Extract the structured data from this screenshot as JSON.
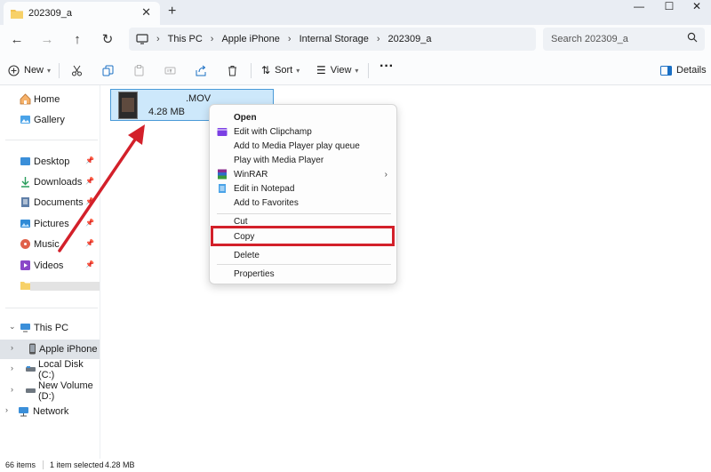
{
  "tab": {
    "title": "202309_a"
  },
  "nav": {
    "back": "back",
    "forward": "forward",
    "up": "up",
    "refresh": "refresh"
  },
  "breadcrumb": [
    "This PC",
    "Apple iPhone",
    "Internal Storage",
    "202309_a"
  ],
  "search": {
    "placeholder": "Search 202309_a"
  },
  "toolbar": {
    "new_label": "New",
    "sort_label": "Sort",
    "view_label": "View",
    "details_label": "Details"
  },
  "sidebar": {
    "top": [
      {
        "label": "Home",
        "icon": "home-icon"
      },
      {
        "label": "Gallery",
        "icon": "gallery-icon"
      }
    ],
    "quick": [
      {
        "label": "Desktop",
        "icon": "desktop-folder-icon"
      },
      {
        "label": "Downloads",
        "icon": "downloads-folder-icon"
      },
      {
        "label": "Documents",
        "icon": "documents-folder-icon"
      },
      {
        "label": "Pictures",
        "icon": "pictures-folder-icon"
      },
      {
        "label": "Music",
        "icon": "music-folder-icon"
      },
      {
        "label": "Videos",
        "icon": "videos-folder-icon"
      }
    ],
    "tree": [
      {
        "label": "This PC",
        "icon": "pc-icon"
      },
      {
        "label": "Apple iPhone",
        "icon": "iphone-icon"
      },
      {
        "label": "Local Disk (C:)",
        "icon": "disk-icon"
      },
      {
        "label": "New Volume (D:)",
        "icon": "disk-icon"
      },
      {
        "label": "Network",
        "icon": "network-icon"
      }
    ]
  },
  "file": {
    "name": ".MOV",
    "size": "4.28 MB"
  },
  "context_menu": {
    "open": "Open",
    "clipchamp": "Edit with Clipchamp",
    "add_queue": "Add to Media Player play queue",
    "play": "Play with Media Player",
    "winrar": "WinRAR",
    "notepad": "Edit in Notepad",
    "favorites": "Add to Favorites",
    "cut": "Cut",
    "copy": "Copy",
    "delete": "Delete",
    "properties": "Properties"
  },
  "status": {
    "count": "66 items",
    "selected": "1 item selected",
    "size": "4.28 MB"
  },
  "colors": {
    "highlight": "#d3202a",
    "selection": "#cde8fb",
    "accent": "#0067c0"
  }
}
